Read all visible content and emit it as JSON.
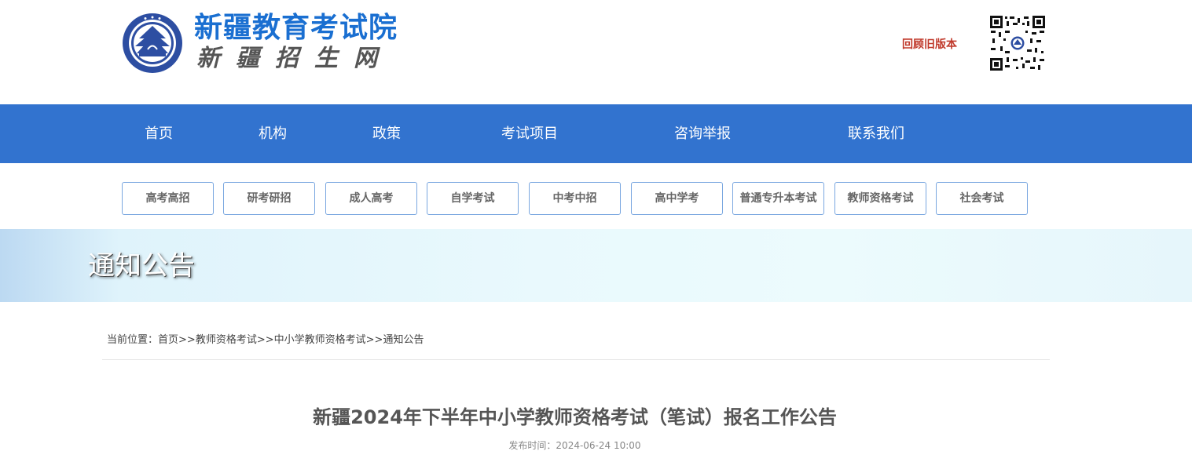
{
  "header": {
    "title": "新疆教育考试院",
    "subtitle": "新疆招生网",
    "old_version_link": "回顾旧版本",
    "logo_icon": "exam-institute-emblem-icon",
    "qr_icon": "qr-code-icon"
  },
  "mainnav": {
    "items": [
      "首页",
      "机构",
      "政策",
      "考试项目",
      "咨询举报",
      "联系我们"
    ]
  },
  "subnav": {
    "items": [
      "高考高招",
      "研考研招",
      "成人高考",
      "自学考试",
      "中考中招",
      "高中学考",
      "普通专升本考试",
      "教师资格考试",
      "社会考试"
    ]
  },
  "banner": {
    "title": "通知公告"
  },
  "breadcrumb": {
    "label": "当前位置：",
    "items": [
      "首页",
      "教师资格考试",
      "中小学教师资格考试",
      "通知公告"
    ],
    "separator": ">>"
  },
  "article": {
    "title": "新疆2024年下半年中小学教师资格考试（笔试）报名工作公告",
    "publish_time": "发布时间：2024-06-24 10:00"
  },
  "colors": {
    "nav_bg": "#3273cf",
    "title_blue": "#1a6fd1",
    "link_red": "#c0392b",
    "button_border": "#7aa7e0"
  }
}
